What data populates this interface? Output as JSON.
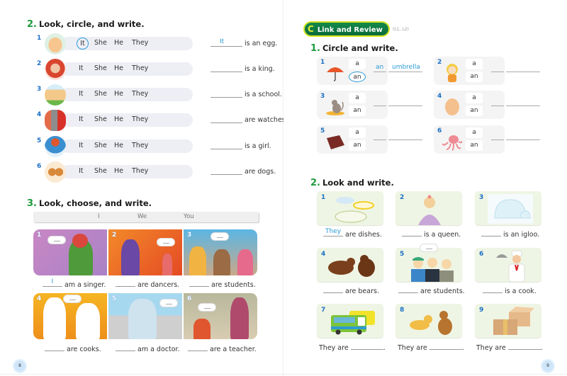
{
  "left_page": {
    "page_number": "8",
    "ex2": {
      "number": "2.",
      "title": "Look, circle, and write.",
      "options": [
        "It",
        "She",
        "He",
        "They"
      ],
      "items": [
        {
          "n": "1",
          "picture": "egg",
          "circled": "It",
          "answer": "It",
          "sentence": "is an egg."
        },
        {
          "n": "2",
          "picture": "king",
          "circled": "",
          "answer": "",
          "sentence": "is a king."
        },
        {
          "n": "3",
          "picture": "school",
          "circled": "",
          "answer": "",
          "sentence": "is a school."
        },
        {
          "n": "4",
          "picture": "watches",
          "circled": "",
          "answer": "",
          "sentence": "are watches."
        },
        {
          "n": "5",
          "picture": "girl",
          "circled": "",
          "answer": "",
          "sentence": "is a girl."
        },
        {
          "n": "6",
          "picture": "dogs",
          "circled": "",
          "answer": "",
          "sentence": "are dogs."
        }
      ]
    },
    "ex3": {
      "number": "3.",
      "title": "Look, choose, and write.",
      "word_bank": [
        "I",
        "We",
        "You"
      ],
      "items": [
        {
          "n": "1",
          "scene": "singer",
          "answer": "I",
          "sentence": "am a singer."
        },
        {
          "n": "2",
          "scene": "dancers",
          "answer": "",
          "sentence": "are dancers."
        },
        {
          "n": "3",
          "scene": "students",
          "answer": "",
          "sentence": "are students."
        },
        {
          "n": "4",
          "scene": "cooks",
          "answer": "",
          "sentence": "are cooks."
        },
        {
          "n": "5",
          "scene": "doctor",
          "answer": "",
          "sentence": "am a doctor."
        },
        {
          "n": "6",
          "scene": "teacher",
          "answer": "",
          "sentence": "are a teacher."
        }
      ]
    }
  },
  "right_page": {
    "page_number": "9",
    "section_badge": {
      "letter": "C",
      "title": "Link and Review",
      "subtitle": "(L1, L2)"
    },
    "ex1": {
      "number": "1.",
      "title": "Circle and write.",
      "choices": [
        "a",
        "an"
      ],
      "items": [
        {
          "n": "1",
          "picture": "umbrella",
          "circled": "an",
          "article": "an",
          "word": "umbrella"
        },
        {
          "n": "2",
          "picture": "girl",
          "circled": "",
          "article": "",
          "word": ""
        },
        {
          "n": "3",
          "picture": "cat",
          "circled": "",
          "article": "",
          "word": ""
        },
        {
          "n": "4",
          "picture": "egg",
          "circled": "",
          "article": "",
          "word": ""
        },
        {
          "n": "5",
          "picture": "book",
          "circled": "",
          "article": "",
          "word": ""
        },
        {
          "n": "6",
          "picture": "octopus",
          "circled": "",
          "article": "",
          "word": ""
        }
      ]
    },
    "ex2": {
      "number": "2.",
      "title": "Look and write.",
      "items": [
        {
          "n": "1",
          "picture": "dishes",
          "answer": "They",
          "sentence": "are dishes."
        },
        {
          "n": "2",
          "picture": "queen",
          "answer": "",
          "sentence": "is a queen."
        },
        {
          "n": "3",
          "picture": "igloo",
          "answer": "",
          "sentence": "is an igloo."
        },
        {
          "n": "4",
          "picture": "bears",
          "answer": "",
          "sentence": "are bears."
        },
        {
          "n": "5",
          "picture": "students",
          "answer": "",
          "sentence": "are students."
        },
        {
          "n": "6",
          "picture": "cook",
          "answer": "",
          "sentence": "is a cook."
        },
        {
          "n": "7",
          "picture": "buses",
          "prefix": "They are",
          "sentence_end": "."
        },
        {
          "n": "8",
          "picture": "dogs",
          "prefix": "They are",
          "sentence_end": "."
        },
        {
          "n": "9",
          "picture": "boxes",
          "prefix": "They are",
          "sentence_end": "."
        }
      ]
    }
  },
  "colors": {
    "accent_green": "#1e9b3c",
    "answer_blue": "#2a9bd7",
    "number_blue": "#1a6fc4",
    "badge_green": "#0b6b39",
    "badge_yellow": "#d7e51f"
  }
}
